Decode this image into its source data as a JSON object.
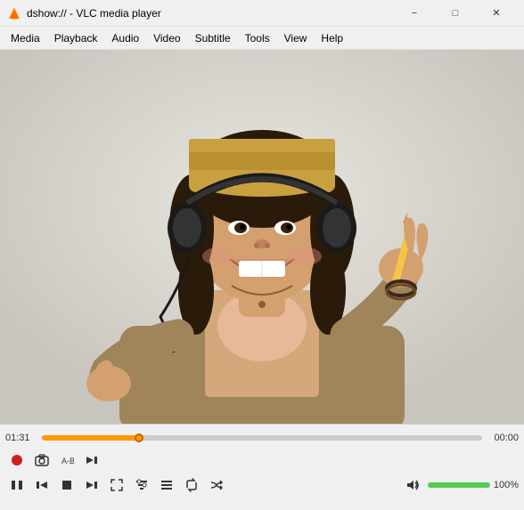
{
  "titlebar": {
    "title": "dshow:// - VLC media player",
    "icon": "vlc-icon",
    "controls": {
      "minimize": "−",
      "maximize": "□",
      "close": "✕"
    }
  },
  "menubar": {
    "items": [
      "Media",
      "Playback",
      "Audio",
      "Video",
      "Subtitle",
      "Tools",
      "View",
      "Help"
    ]
  },
  "timeline": {
    "current": "01:31",
    "remaining": "00:00",
    "progress_pct": 22
  },
  "controls_row1": {
    "buttons": [
      {
        "name": "record",
        "icon": "⏺",
        "label": "Record"
      },
      {
        "name": "snapshot",
        "icon": "📷",
        "label": "Snapshot"
      },
      {
        "name": "loop-ab",
        "icon": "⇄",
        "label": "Loop A-B"
      },
      {
        "name": "frame-step",
        "icon": "⏭",
        "label": "Frame Step"
      }
    ]
  },
  "controls_row2": {
    "buttons": [
      {
        "name": "play-pause",
        "icon": "⏸",
        "label": "Play/Pause"
      },
      {
        "name": "prev",
        "icon": "⏮",
        "label": "Previous"
      },
      {
        "name": "stop",
        "icon": "⏹",
        "label": "Stop"
      },
      {
        "name": "next",
        "icon": "⏭",
        "label": "Next"
      },
      {
        "name": "fullscreen",
        "icon": "⛶",
        "label": "Fullscreen"
      },
      {
        "name": "extended",
        "icon": "☰",
        "label": "Extended"
      },
      {
        "name": "playlist",
        "icon": "☰",
        "label": "Playlist"
      },
      {
        "name": "repeat",
        "icon": "↻",
        "label": "Repeat"
      },
      {
        "name": "random",
        "icon": "⇀",
        "label": "Random"
      }
    ]
  },
  "volume": {
    "level": 100,
    "label": "100%",
    "icon": "🔊"
  }
}
